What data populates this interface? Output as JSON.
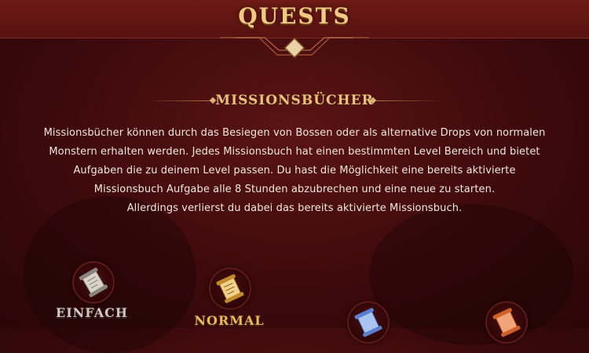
{
  "header": {
    "title": "QUESTS"
  },
  "section": {
    "title": "MISSIONSBÜCHER"
  },
  "description": {
    "lines": [
      "Missionsbücher können durch das Besiegen von Bossen oder als alternative Drops von normalen",
      "Monstern erhalten werden. Jedes Missionsbuch hat einen bestimmten Level Bereich und bietet",
      "Aufgaben die zu deinem Level passen. Du hast die Möglichkeit eine bereits aktivierte",
      "Missionsbuch Aufgabe alle 8 Stunden abzubrechen und eine neue zu starten.",
      "Allerdings verlierst du dabei das bereits aktivierte Missionsbuch."
    ]
  },
  "books": [
    {
      "label": "EINFACH",
      "icon": "scroll-icon",
      "color": "#c9c1b8"
    },
    {
      "label": "NORMAL",
      "icon": "scroll-icon",
      "color": "#e1b25a"
    },
    {
      "label": "",
      "icon": "scroll-icon",
      "color": "#7fa6e8"
    },
    {
      "label": "",
      "icon": "scroll-icon",
      "color": "#e87a4a"
    }
  ],
  "colors": {
    "gold": "#f0c983",
    "background": "#3e0a0c",
    "header": "#6e1a16"
  }
}
